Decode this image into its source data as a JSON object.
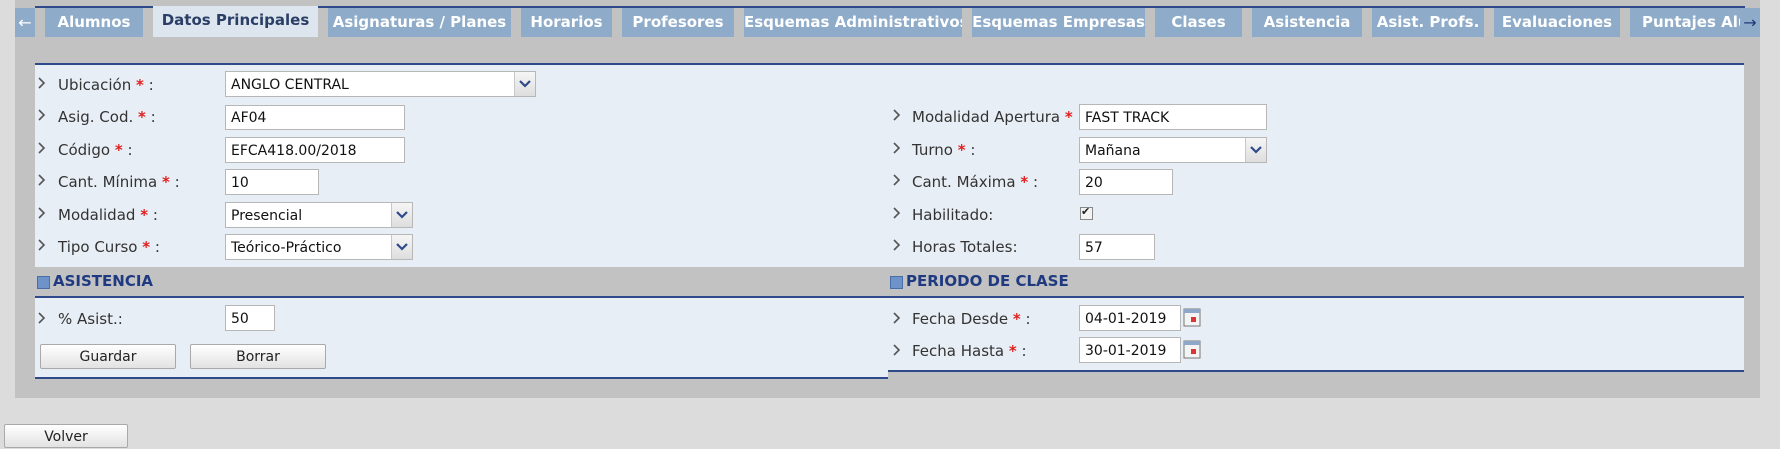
{
  "tabs": [
    {
      "label": "Alumnos",
      "active": false
    },
    {
      "label": "Datos Principales",
      "active": true
    },
    {
      "label": "Asignaturas / Planes",
      "active": false
    },
    {
      "label": "Horarios",
      "active": false
    },
    {
      "label": "Profesores",
      "active": false
    },
    {
      "label": "Esquemas Administrativos",
      "active": false
    },
    {
      "label": "Esquemas Empresas",
      "active": false
    },
    {
      "label": "Clases",
      "active": false
    },
    {
      "label": "Asistencia",
      "active": false
    },
    {
      "label": "Asist. Profs.",
      "active": false
    },
    {
      "label": "Evaluaciones",
      "active": false
    },
    {
      "label": "Puntajes Alum",
      "active": false
    }
  ],
  "tab_arrows": {
    "left": "←",
    "right": "→"
  },
  "left_fields": {
    "ubicacion": {
      "label": "Ubicación",
      "required": "*",
      "suffix": ":",
      "value": "ANGLO CENTRAL"
    },
    "asig_cod": {
      "label": "Asig. Cod.",
      "required": "*",
      "suffix": ":",
      "value": "AF04"
    },
    "codigo": {
      "label": "Código",
      "required": "*",
      "suffix": ":",
      "value": "EFCA418.00/2018"
    },
    "cant_minima": {
      "label": "Cant. Mínima",
      "required": "*",
      "suffix": ":",
      "value": "10"
    },
    "modalidad": {
      "label": "Modalidad",
      "required": "*",
      "suffix": ":",
      "value": "Presencial"
    },
    "tipo_curso": {
      "label": "Tipo Curso",
      "required": "*",
      "suffix": ":",
      "value": "Teórico-Práctico"
    }
  },
  "right_fields": {
    "modalidad_apertura": {
      "label": "Modalidad Apertura",
      "required": "*",
      "suffix": ":",
      "value": "FAST TRACK"
    },
    "turno": {
      "label": "Turno",
      "required": "*",
      "suffix": ":",
      "value": "Mañana"
    },
    "cant_maxima": {
      "label": "Cant. Máxima",
      "required": "*",
      "suffix": ":",
      "value": "20"
    },
    "habilitado": {
      "label": "Habilitado:",
      "checked": true,
      "check_mark": "✔"
    },
    "horas_totales": {
      "label": "Horas Totales:",
      "value": "57"
    }
  },
  "sections": {
    "asistencia": {
      "title": "ASISTENCIA",
      "pct_asist": {
        "label": "% Asist.:",
        "value": "50"
      },
      "save_label": "Guardar",
      "delete_label": "Borrar"
    },
    "periodo": {
      "title": "PERIODO DE CLASE",
      "fecha_desde": {
        "label": "Fecha Desde",
        "required": "*",
        "suffix": ":",
        "value": "04-01-2019"
      },
      "fecha_hasta": {
        "label": "Fecha Hasta",
        "required": "*",
        "suffix": ":",
        "value": "30-01-2019"
      }
    }
  },
  "footer": {
    "back_label": "Volver"
  },
  "colors": {
    "accent": "#2f4a8a",
    "tab_bg": "#8eabc9",
    "panel_bg": "#e8eef5",
    "required": "#e02020"
  }
}
